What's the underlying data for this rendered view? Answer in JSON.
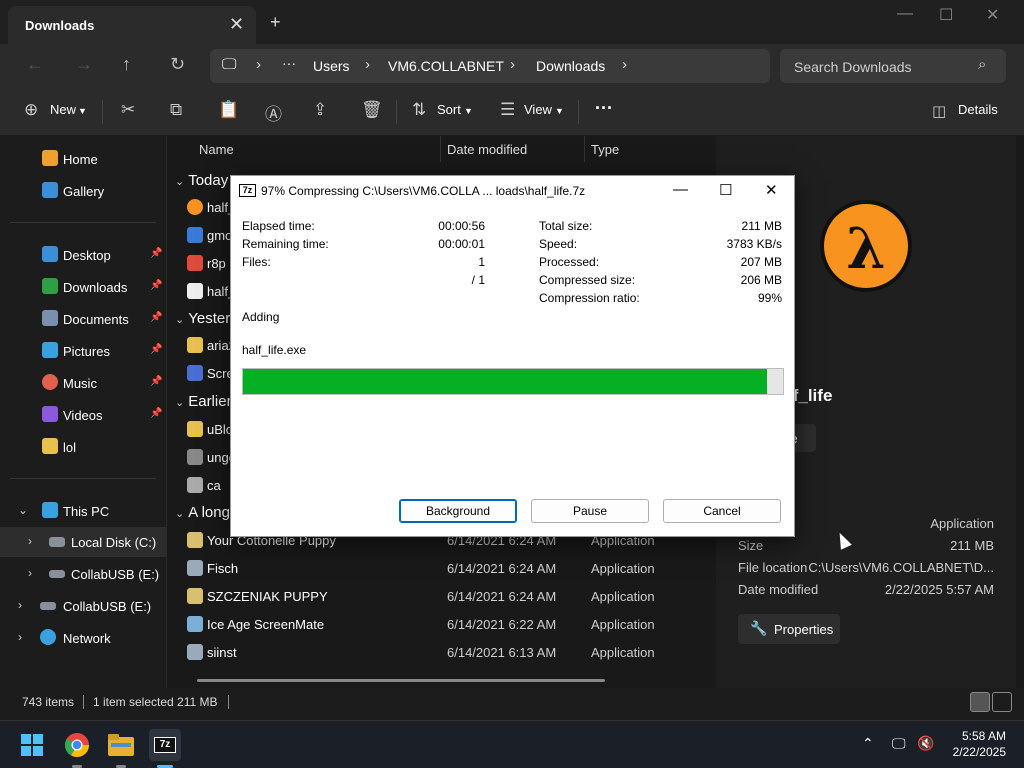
{
  "explorer": {
    "tab_title": "Downloads",
    "tab_close": "✕",
    "new_tab": "+",
    "window_controls": [
      "—",
      "☐",
      "✕"
    ],
    "breadcrumb": [
      "Users",
      "VM6.COLLABNET",
      "Downloads"
    ],
    "breadcrumb_more": "···",
    "search_placeholder": "Search Downloads",
    "toolbar": {
      "new_label": "New",
      "sort_label": "Sort",
      "view_label": "View",
      "more": "···",
      "details_label": "Details"
    },
    "sidebar": {
      "quick": [
        {
          "label": "Home",
          "color": "#f0a030"
        },
        {
          "label": "Gallery",
          "color": "#3a8fd8"
        }
      ],
      "pinned": [
        {
          "label": "Desktop",
          "color": "#3a8fd8"
        },
        {
          "label": "Downloads",
          "color": "#2ea043"
        },
        {
          "label": "Documents",
          "color": "#7a8fb0"
        },
        {
          "label": "Pictures",
          "color": "#3aa0e0"
        },
        {
          "label": "Music",
          "color": "#e06050"
        },
        {
          "label": "Videos",
          "color": "#8a5ad8"
        },
        {
          "label": "lol",
          "color": "#e8c050"
        }
      ],
      "this_pc": "This PC",
      "drives": [
        "Local Disk (C:)",
        "CollabUSB (E:)"
      ],
      "collab_root": "CollabUSB (E:)",
      "network": "Network"
    },
    "columns": [
      "Name",
      "Date modified",
      "Type"
    ],
    "groups": [
      {
        "label": "Today",
        "rows": [
          "half_",
          "gmo",
          "r8p",
          "half_"
        ]
      },
      {
        "label": "Yester",
        "rows": [
          "aria2",
          "Scre"
        ]
      },
      {
        "label": "Earlier",
        "rows": [
          "uBlo",
          "ungo",
          "ca"
        ]
      },
      {
        "label": "A long"
      }
    ],
    "long_rows": [
      {
        "name": "Your Cottonelle Puppy",
        "date": "6/14/2021 6:24 AM",
        "type": "Application"
      },
      {
        "name": "Fisch",
        "date": "6/14/2021 6:24 AM",
        "type": "Application"
      },
      {
        "name": "SZCZENIAK PUPPY",
        "date": "6/14/2021 6:24 AM",
        "type": "Application"
      },
      {
        "name": "Ice Age ScreenMate",
        "date": "6/14/2021 6:22 AM",
        "type": "Application"
      },
      {
        "name": "siinst",
        "date": "6/14/2021 6:13 AM",
        "type": "Application"
      }
    ],
    "details_pane": {
      "title": "lf_life",
      "share_label": "re",
      "type_value": "Application",
      "size_label": "Size",
      "size_value": "211 MB",
      "location_label": "File location",
      "location_value": "C:\\Users\\VM6.COLLABNET\\D...",
      "modified_label": "Date modified",
      "modified_value": "2/22/2025 5:57 AM",
      "properties_label": "Properties"
    },
    "status": {
      "items": "743 items",
      "selected": "1 item selected  211 MB"
    }
  },
  "dialog": {
    "title": "97% Compressing C:\\Users\\VM6.COLLA ... loads\\half_life.7z",
    "logo": "7z",
    "elapsed_label": "Elapsed time:",
    "elapsed_value": "00:00:56",
    "remaining_label": "Remaining time:",
    "remaining_value": "00:00:01",
    "files_label": "Files:",
    "files_value": "1",
    "files_total": "/ 1",
    "total_size_label": "Total size:",
    "total_size_value": "211 MB",
    "speed_label": "Speed:",
    "speed_value": "3783 KB/s",
    "processed_label": "Processed:",
    "processed_value": "207 MB",
    "compressed_label": "Compressed size:",
    "compressed_value": "206 MB",
    "ratio_label": "Compression ratio:",
    "ratio_value": "99%",
    "action": "Adding",
    "current_file": "half_life.exe",
    "progress_fraction": 0.97,
    "buttons": {
      "background": "Background",
      "pause": "Pause",
      "cancel": "Cancel"
    }
  },
  "taskbar": {
    "clock_time": "5:58 AM",
    "clock_date": "2/22/2025",
    "app_7z": "7z"
  },
  "colors": {
    "progress_fill": "#06b025",
    "accent": "#4cc2ff"
  }
}
